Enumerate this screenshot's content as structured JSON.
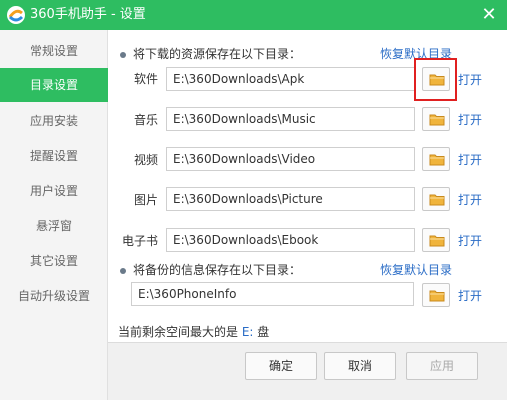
{
  "window": {
    "title": "360手机助手 - 设置",
    "close": "✕"
  },
  "sidebar": {
    "items": [
      {
        "label": "常规设置"
      },
      {
        "label": "目录设置"
      },
      {
        "label": "应用安装"
      },
      {
        "label": "提醒设置"
      },
      {
        "label": "用户设置"
      },
      {
        "label": "悬浮窗"
      },
      {
        "label": "其它设置"
      },
      {
        "label": "自动升级设置"
      }
    ],
    "active_index": 1
  },
  "main": {
    "download_section": {
      "label": "将下载的资源保存在以下目录：",
      "restore_default": "恢复默认目录",
      "rows": [
        {
          "label": "软件",
          "path": "E:\\360Downloads\\Apk",
          "open": "打开"
        },
        {
          "label": "音乐",
          "path": "E:\\360Downloads\\Music",
          "open": "打开"
        },
        {
          "label": "视频",
          "path": "E:\\360Downloads\\Video",
          "open": "打开"
        },
        {
          "label": "图片",
          "path": "E:\\360Downloads\\Picture",
          "open": "打开"
        },
        {
          "label": "电子书",
          "path": "E:\\360Downloads\\Ebook",
          "open": "打开"
        }
      ]
    },
    "backup_section": {
      "label": "将备份的信息保存在以下目录：",
      "restore_default": "恢复默认目录",
      "path": "E:\\360PhoneInfo",
      "open": "打开"
    },
    "status_prefix": "当前剩余空间最大的是 ",
    "status_drive": "E:",
    "status_suffix": " 盘"
  },
  "footer": {
    "ok": "确定",
    "cancel": "取消",
    "apply": "应用"
  },
  "colors": {
    "accent": "#2ebd61",
    "link": "#2a6cc6",
    "highlight": "#e02020",
    "folder": "#f0b43c"
  },
  "icons": {
    "logo": "app-logo-icon",
    "folder": "folder-icon",
    "close": "close-icon"
  }
}
